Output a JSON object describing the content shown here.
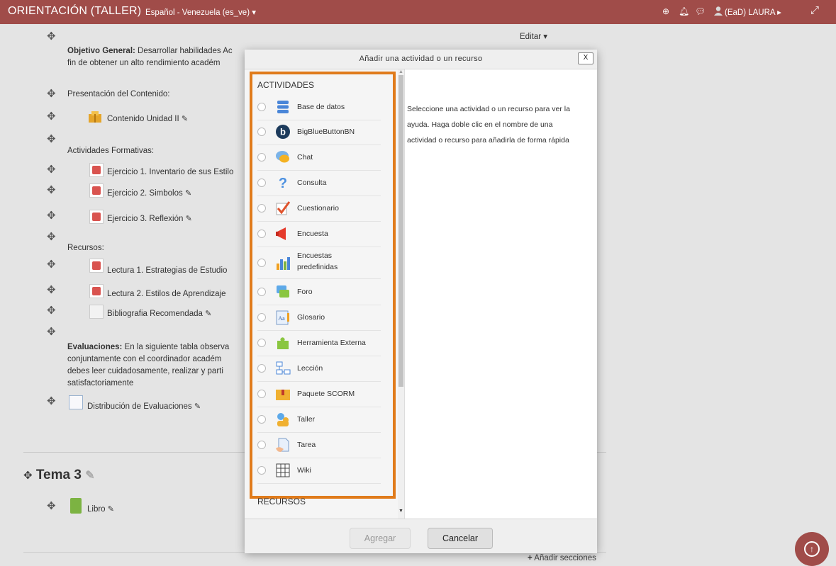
{
  "topbar": {
    "title": "ORIENTACIÓN (TALLER)",
    "language": "Español - Venezuela (es_ve) ▾",
    "user": "(EaD) LAURA ▸",
    "icons": [
      "plus-circle-icon",
      "bell-icon",
      "chat-icon",
      "user-icon",
      "expand-icon"
    ],
    "accent_color": "#a04c49"
  },
  "course": {
    "edit_label": "Editar ▾",
    "objective_label": "Objetivo General:",
    "objective_text1": " Desarrollar habilidades Ac",
    "objective_text2": "fin de obtener un alto rendimiento académ",
    "presentation": "Presentación del Contenido:",
    "content_unit": "Contenido Unidad II",
    "formative_heading": "Actividades Formativas:",
    "exercise1": "Ejercicio 1. Inventario de sus Estilo",
    "exercise2": "Ejercicio 2. Simbolos",
    "exercise3": "Ejercicio 3. Reflexión",
    "resources_heading": "Recursos:",
    "reading1": "Lectura 1. Estrategias de Estudio",
    "reading2": "Lectura 2. Estilos de Aprendizaje",
    "bibliography": "Bibliografia Recomendada",
    "eval_label": "Evaluaciones:",
    "eval_text1": " En la siguiente tabla observa",
    "eval_text2": "conjuntamente con el coordinador académ",
    "eval_text3": "debes leer cuidadosamente, realizar y parti",
    "eval_text4": "satisfactoriamente",
    "distribution": "Distribución de Evaluaciones",
    "topic3": "Tema 3",
    "book": "Libro",
    "add_sections": "Añadir secciones"
  },
  "modal": {
    "title": "Añadir una actividad o un recurso",
    "close_label": "X",
    "activities_heading": "ACTIVIDADES",
    "resources_heading": "RECURSOS",
    "activities": [
      {
        "label": "Base de datos",
        "icon": "database-icon"
      },
      {
        "label": "BigBlueButtonBN",
        "icon": "bigbluebutton-icon"
      },
      {
        "label": "Chat",
        "icon": "chat-bubble-icon"
      },
      {
        "label": "Consulta",
        "icon": "question-icon"
      },
      {
        "label": "Cuestionario",
        "icon": "quiz-check-icon"
      },
      {
        "label": "Encuesta",
        "icon": "megaphone-icon"
      },
      {
        "label": "Encuestas",
        "label2": "predefinidas",
        "icon": "bar-chart-icon"
      },
      {
        "label": "Foro",
        "icon": "forum-icon"
      },
      {
        "label": "Glosario",
        "icon": "glossary-icon"
      },
      {
        "label": "Herramienta Externa",
        "icon": "puzzle-icon"
      },
      {
        "label": "Lección",
        "icon": "lesson-icon"
      },
      {
        "label": "Paquete SCORM",
        "icon": "scorm-package-icon"
      },
      {
        "label": "Taller",
        "icon": "workshop-icon"
      },
      {
        "label": "Tarea",
        "icon": "assignment-icon"
      },
      {
        "label": "Wiki",
        "icon": "wiki-icon"
      }
    ],
    "help_text": "Seleccione una actividad o un recurso para ver la ayuda. Haga doble clic en el nombre de una actividad o recurso para añadirla de forma rápida",
    "add_button": "Agregar",
    "cancel_button": "Cancelar",
    "highlight_color": "#e07b1b"
  }
}
